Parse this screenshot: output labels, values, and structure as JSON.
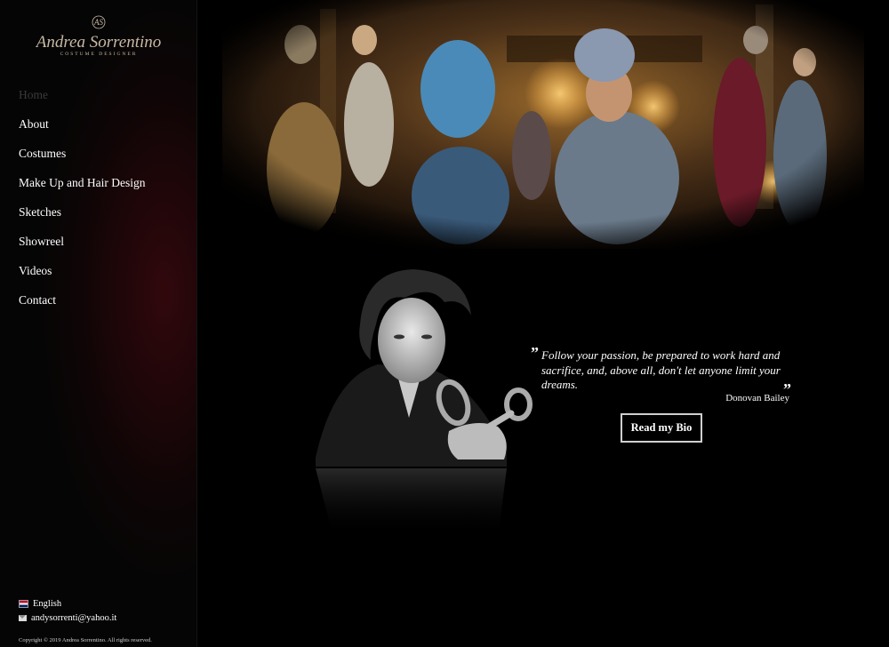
{
  "brand": {
    "monogram": "AS",
    "name": "Andrea Sorrentino",
    "tagline": "COSTUME DESIGNER"
  },
  "nav": {
    "items": [
      {
        "label": "Home",
        "active": true
      },
      {
        "label": "About"
      },
      {
        "label": "Costumes"
      },
      {
        "label": "Make Up and Hair Design"
      },
      {
        "label": "Sketches"
      },
      {
        "label": "Showreel"
      },
      {
        "label": "Videos"
      },
      {
        "label": "Contact"
      }
    ]
  },
  "footer": {
    "language": "English",
    "language_icon": "uk-flag-icon",
    "email": "andysorrenti@yahoo.it",
    "email_icon": "mail-icon",
    "copyright": "Copyright © 2019 Andrea Sorrentino. All rights reserved."
  },
  "quote": {
    "text": "Follow your passion, be prepared to work hard and sacrifice, and, above all, don't let anyone limit your dreams.",
    "author": "Donovan Bailey",
    "open_mark": "”",
    "close_mark": "”"
  },
  "cta": {
    "bio_label": "Read my Bio"
  },
  "colors": {
    "background": "#000000",
    "sidebar_accent": "#550a12",
    "nav_active": "#3a3a3a",
    "logo_gold": "#c9b9a6"
  }
}
